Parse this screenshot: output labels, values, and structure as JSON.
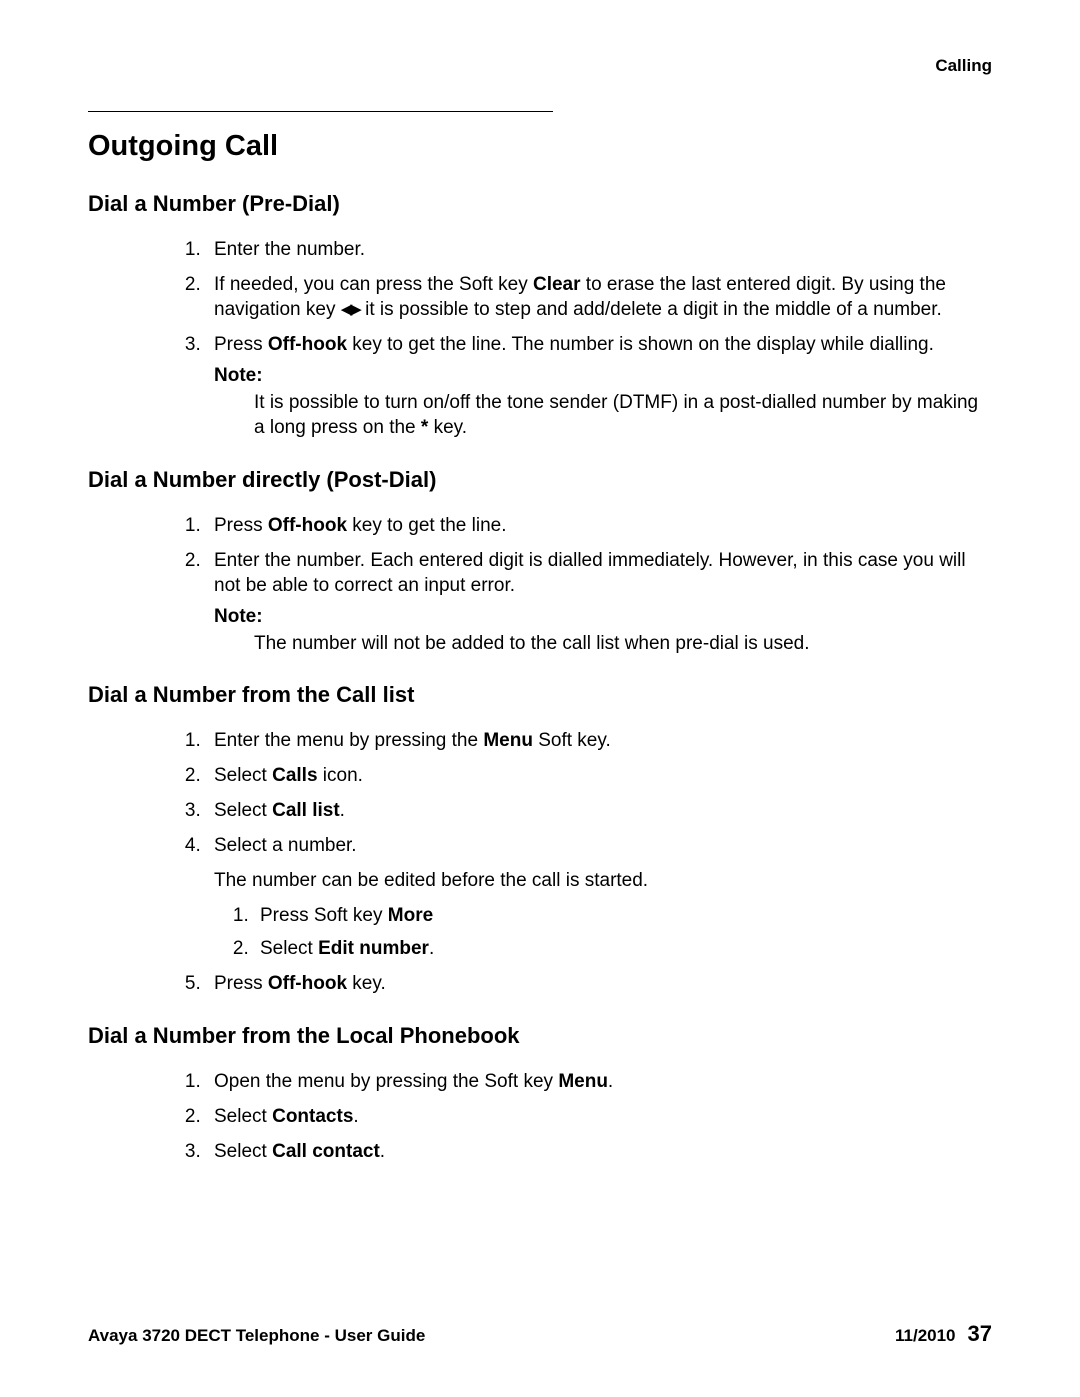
{
  "header": {
    "section": "Calling"
  },
  "title": "Outgoing Call",
  "sections": {
    "predial": {
      "heading": "Dial a Number (Pre-Dial)",
      "item1": "Enter the number.",
      "item2_a": "If needed, you can press the Soft key ",
      "item2_b": "Clear",
      "item2_c": " to erase the last entered digit. By using the navigation key ",
      "item2_d": " it is possible to step and add/delete a digit in the middle of a number.",
      "item3_a": "Press ",
      "item3_b": "Off-hook",
      "item3_c": " key to get the line. The number is shown on the display while dialling.",
      "note_label": "Note:",
      "note_a": "It is possible to turn on/off the tone sender (DTMF) in a post-dialled number by making a long press on the ",
      "note_b": "*",
      "note_c": " key."
    },
    "postdial": {
      "heading": "Dial a Number directly (Post-Dial)",
      "item1_a": "Press ",
      "item1_b": "Off-hook",
      "item1_c": " key to get the line.",
      "item2": "Enter the number. Each entered digit is dialled immediately. However, in this case you will not be able to correct an input error.",
      "note_label": "Note:",
      "note_text": "The number will not be added to the call list when pre-dial is used."
    },
    "calllist": {
      "heading": "Dial a Number from the Call list",
      "item1_a": "Enter the menu by pressing the ",
      "item1_b": "Menu",
      "item1_c": " Soft key.",
      "item2_a": "Select ",
      "item2_b": "Calls",
      "item2_c": " icon.",
      "item3_a": "Select ",
      "item3_b": "Call list",
      "item3_c": ".",
      "item4": "Select a number.",
      "item4_extra": "The number can be edited before the call is started.",
      "sub1_a": "Press Soft key ",
      "sub1_b": "More",
      "sub2_a": "Select ",
      "sub2_b": "Edit number",
      "sub2_c": ".",
      "item5_a": "Press ",
      "item5_b": "Off-hook",
      "item5_c": " key."
    },
    "phonebook": {
      "heading": "Dial a Number from the Local Phonebook",
      "item1_a": "Open the menu by pressing the Soft key ",
      "item1_b": "Menu",
      "item1_c": ".",
      "item2_a": "Select ",
      "item2_b": "Contacts",
      "item2_c": ".",
      "item3_a": "Select ",
      "item3_b": "Call contact",
      "item3_c": "."
    }
  },
  "footer": {
    "left": "Avaya 3720 DECT Telephone - User Guide",
    "date": "11/2010",
    "page": "37"
  }
}
